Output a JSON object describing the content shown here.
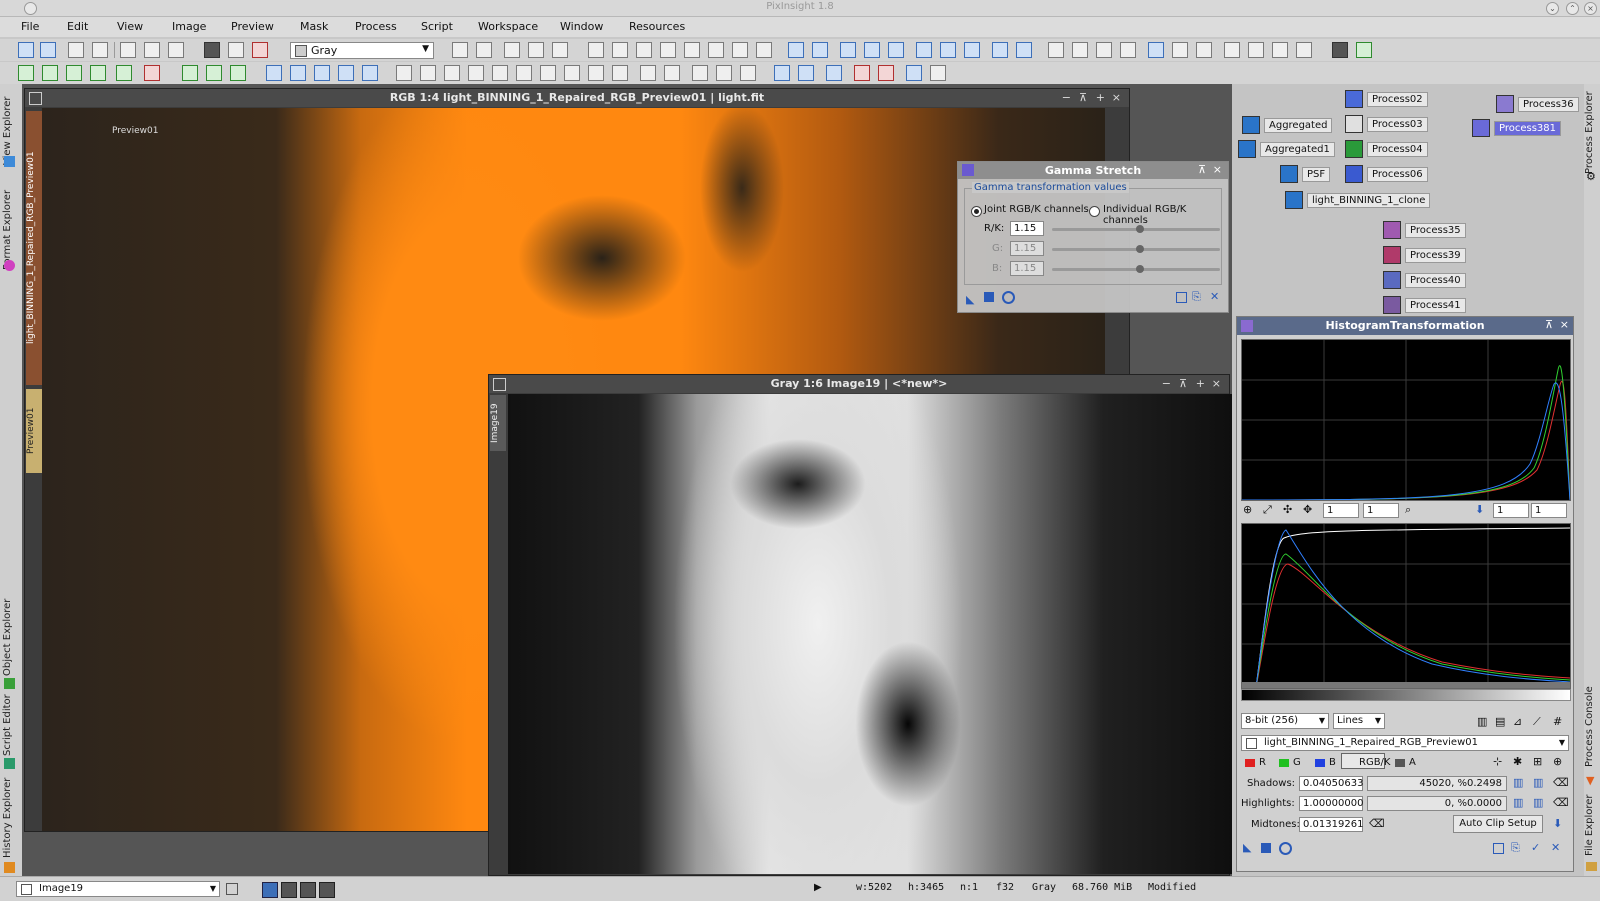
{
  "app": {
    "title": "PixInsight 1.8"
  },
  "menu": [
    "File",
    "Edit",
    "View",
    "Image",
    "Preview",
    "Mask",
    "Process",
    "Script",
    "Workspace",
    "Window",
    "Resources"
  ],
  "toolbar": {
    "color_space_select": "Gray"
  },
  "left_tabs": [
    "View Explorer",
    "Format Explorer",
    "Object Explorer",
    "Script Editor",
    "History Explorer"
  ],
  "right_tabs": [
    "Process Explorer",
    "Process Console",
    "File Explorer"
  ],
  "main_window": {
    "title": "RGB 1:4 light_BINNING_1_Repaired_RGB_Preview01 | light.fit",
    "preview_label": "Preview01",
    "side_tabs": [
      "light_BINNING_1_Repaired_RGB_Preview01",
      "Preview01"
    ]
  },
  "image19_window": {
    "title": "Gray 1:6 Image19 | <*new*>",
    "side_tab": "Image19"
  },
  "gamma": {
    "title": "Gamma Stretch",
    "group": "Gamma transformation values",
    "radio_joint": "Joint RGB/K channels",
    "radio_individual": "Individual RGB/K channels",
    "rk_label": "R/K:",
    "rk_value": "1.15",
    "g_label": "G:",
    "g_value": "1.15",
    "b_label": "B:",
    "b_value": "1.15"
  },
  "process_icons": [
    {
      "label": "Process02",
      "color": "#4a6ad8"
    },
    {
      "label": "Process03",
      "color": "#e0e0e0"
    },
    {
      "label": "Process04",
      "color": "#2a9a3a"
    },
    {
      "label": "Process06",
      "color": "#3a5ad0"
    },
    {
      "label": "Aggregated",
      "color": "#2a74c8"
    },
    {
      "label": "Aggregated1",
      "color": "#2a74c8"
    },
    {
      "label": "PSF",
      "color": "#2a74c8"
    },
    {
      "label": "light_BINNING_1_clone",
      "color": "#2a74c8"
    },
    {
      "label": "Process35",
      "color": "#a05ab0"
    },
    {
      "label": "Process39",
      "color": "#b03a6a"
    },
    {
      "label": "Process40",
      "color": "#5a6ac0"
    },
    {
      "label": "Process41",
      "color": "#7a5aa0"
    },
    {
      "label": "Process36",
      "color": "#8a7ad0"
    },
    {
      "label": "Process381",
      "color": "#6a6ad8"
    }
  ],
  "histogram": {
    "title": "HistogramTransformation",
    "zoom_h1": "1",
    "zoom_v1": "1",
    "zoom_h2": "1",
    "zoom_v2": "1",
    "resolution": "8-bit (256)",
    "plot_mode": "Lines",
    "target_view": "light_BINNING_1_Repaired_RGB_Preview01",
    "channels": [
      "R",
      "G",
      "B",
      "RGB/K",
      "A"
    ],
    "shadows_label": "Shadows:",
    "shadows_value": "0.04050633",
    "shadows_clip": "45020, %0.2498",
    "highlights_label": "Highlights:",
    "highlights_value": "1.00000000",
    "highlights_clip": "0, %0.0000",
    "midtones_label": "Midtones:",
    "midtones_value": "0.01319261",
    "auto_clip": "Auto Clip Setup"
  },
  "status": {
    "view_select": "Image19",
    "width": "w:5202",
    "height": "h:3465",
    "channels": "n:1",
    "format": "f32",
    "colorspace": "Gray",
    "size": "68.760 MiB",
    "state": "Modified"
  }
}
